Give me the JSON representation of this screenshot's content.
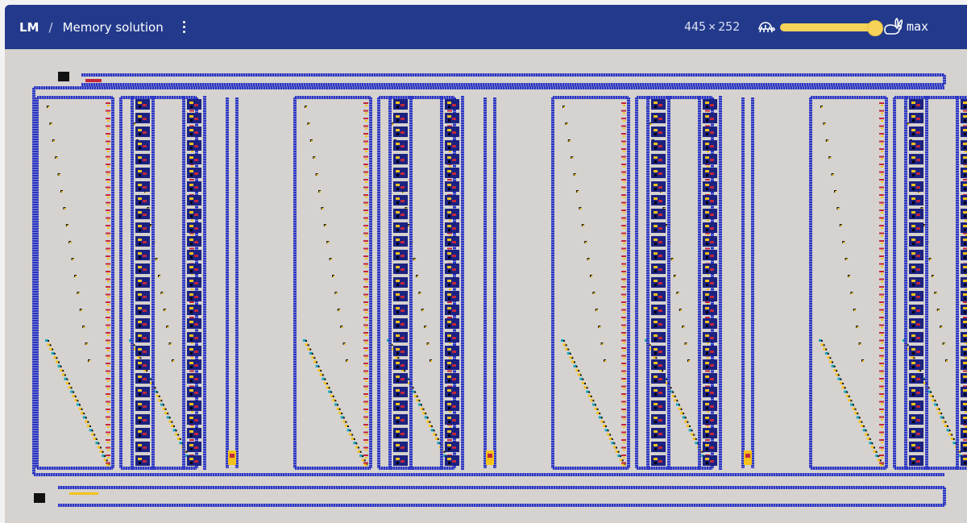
{
  "breadcrumb": {
    "root": "LM",
    "separator": "/",
    "title": "Memory solution",
    "menu_icon": "kebab-menu-icon"
  },
  "toolbar": {
    "dims_width": "445",
    "dims_times": "×",
    "dims_height": "252",
    "slow_icon": "turtle-icon",
    "fast_icon": "rabbit-icon",
    "speed_label": "max",
    "speed_fraction": 1.0
  },
  "colors": {
    "topbar": "#233a8c",
    "canvas_bg": "#d5d2cf",
    "wire": "#2b36c4",
    "dark_wire": "#1b2280",
    "accent_yellow": "#f7d357",
    "signal_yellow": "#f4c21a",
    "signal_red": "#c4263b",
    "signal_black": "#111111",
    "signal_cyan": "#1aa6b8"
  }
}
